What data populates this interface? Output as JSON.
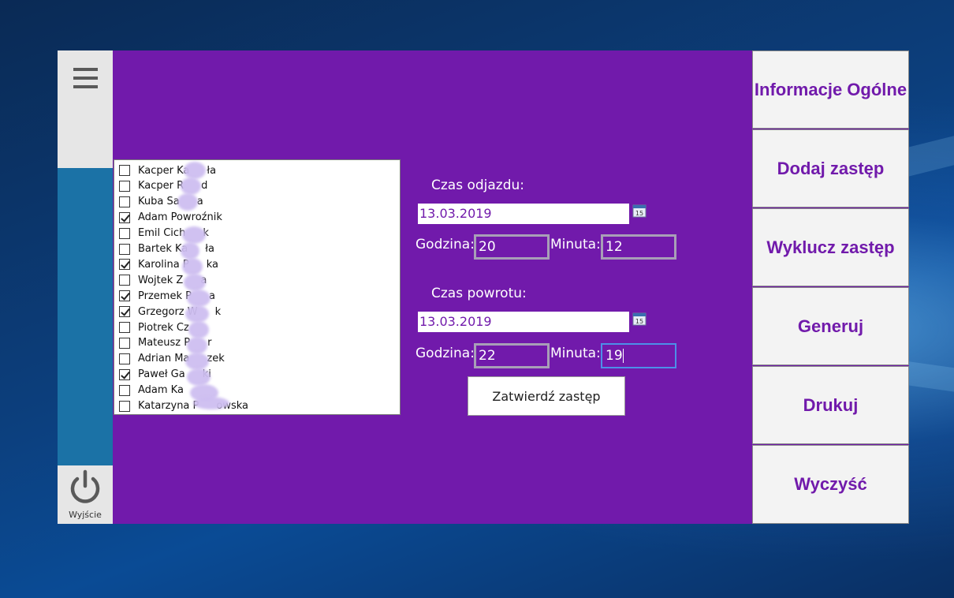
{
  "side_nav": {
    "items": [
      {
        "label": "Informacje Ogólne"
      },
      {
        "label": "Dodaj zastęp"
      },
      {
        "label": "Wyklucz zastęp"
      },
      {
        "label": "Generuj"
      },
      {
        "label": "Drukuj"
      },
      {
        "label": "Wyczyść"
      }
    ]
  },
  "left_rail": {
    "menu_icon": "hamburger-icon",
    "exit_icon": "power-icon",
    "exit_label": "Wyjście"
  },
  "people_list": [
    {
      "name": "Kacper Ka",
      "checked": false
    },
    {
      "name": "Kacper R",
      "checked": false
    },
    {
      "name": "Kuba Sa",
      "checked": false
    },
    {
      "name": "Adam Powroźnik",
      "checked": true
    },
    {
      "name": "Emil Cich",
      "checked": false
    },
    {
      "name": "Bartek Ka",
      "checked": false
    },
    {
      "name": "Karolina P",
      "checked": true
    },
    {
      "name": "Wojtek Z",
      "checked": false
    },
    {
      "name": "Przemek P",
      "checked": true
    },
    {
      "name": "Grzegorz W",
      "checked": true
    },
    {
      "name": "Piotrek Cz",
      "checked": false
    },
    {
      "name": "Mateusz P",
      "checked": false
    },
    {
      "name": "Adrian Ma",
      "checked": false
    },
    {
      "name": "Paweł Ga",
      "checked": true
    },
    {
      "name": "Adam Ka",
      "checked": false
    },
    {
      "name": "Katarzyna P",
      "checked": false
    }
  ],
  "people_list_suffixes": [
    "ła",
    "d",
    "a",
    "",
    "k",
    "ła",
    "ka",
    "a",
    "a",
    "k",
    "",
    "r",
    "zek",
    "ki",
    "",
    "owska"
  ],
  "departure": {
    "label": "Czas odjazdu:",
    "date": "13.03.2019",
    "hour_label": "Godzina:",
    "hour": "20",
    "minute_label": "Minuta:",
    "minute": "12"
  },
  "return": {
    "label": "Czas powrotu:",
    "date": "13.03.2019",
    "hour_label": "Godzina:",
    "hour": "22",
    "minute_label": "Minuta:",
    "minute": "19"
  },
  "calendar_icon_text": "15",
  "confirm_button": "Zatwierdź zastęp",
  "colors": {
    "accent": "#711aab",
    "rail": "#1b72a6",
    "focus": "#4d8fe8"
  }
}
